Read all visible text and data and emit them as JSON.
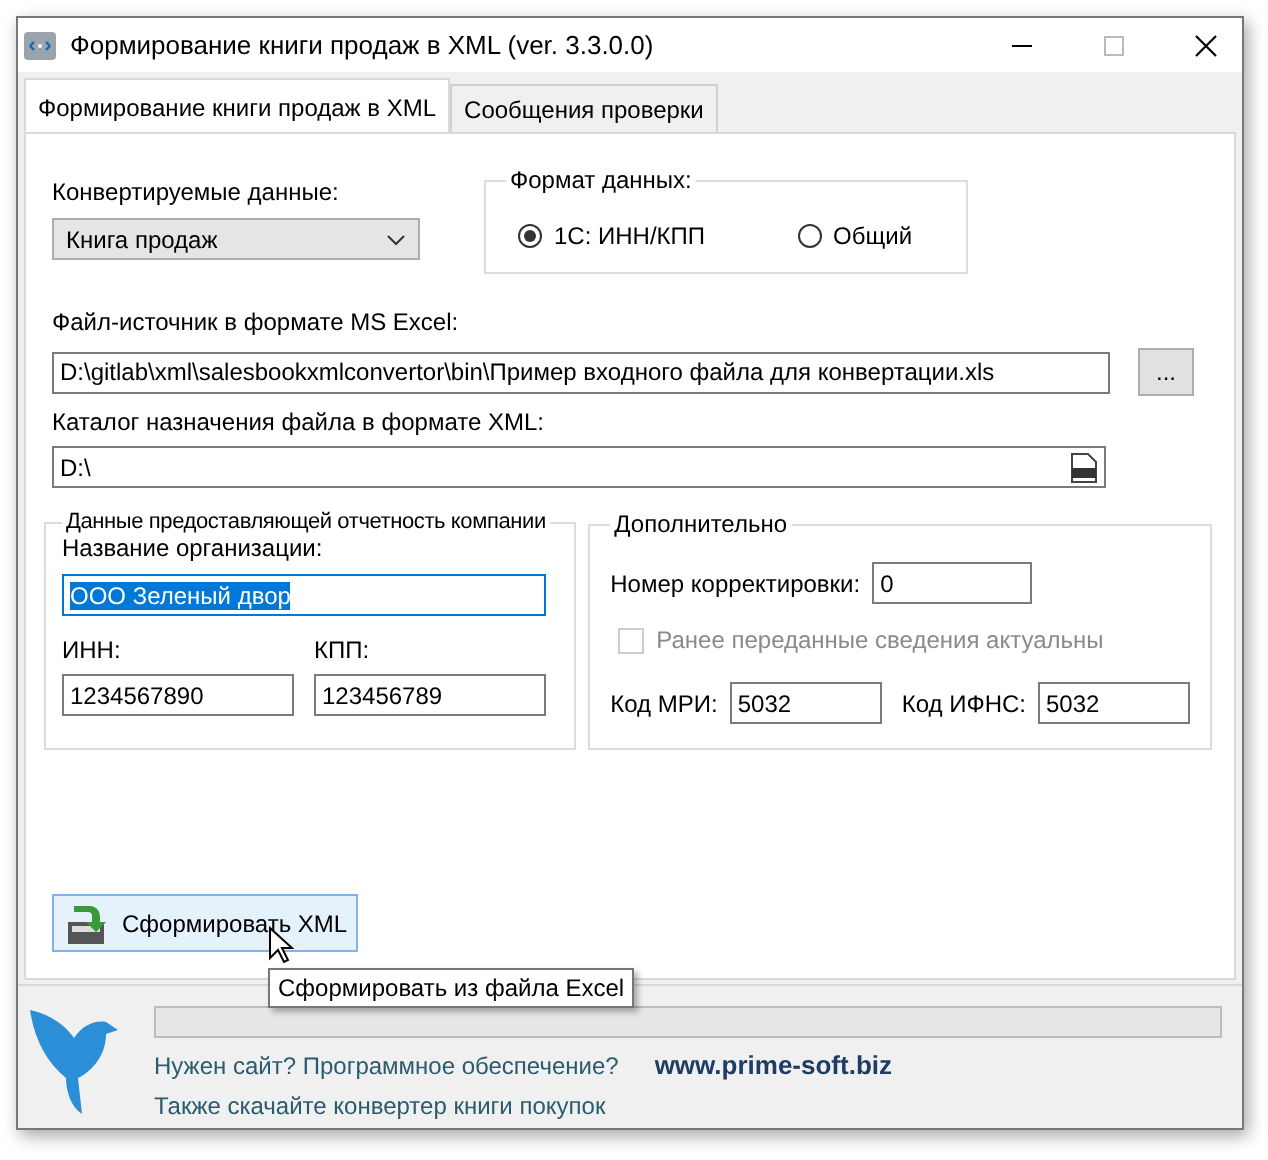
{
  "window": {
    "title": "Формирование книги продаж в XML (ver. 3.3.0.0)"
  },
  "tabs": [
    {
      "label": "Формирование книги продаж в XML",
      "selected": true
    },
    {
      "label": "Сообщения проверки",
      "selected": false
    }
  ],
  "converted_data": {
    "label": "Конвертируемые данные:",
    "value": "Книга продаж"
  },
  "data_format": {
    "title": "Формат данных:",
    "options": [
      {
        "label": "1С: ИНН/КПП",
        "selected": true
      },
      {
        "label": "Общий",
        "selected": false
      }
    ]
  },
  "source_file": {
    "label": "Файл-источник в формате MS Excel:",
    "value": "D:\\gitlab\\xml\\salesbookxmlconvertor\\bin\\Пример входного файла для конвертации.xls",
    "browse": "..."
  },
  "target_dir": {
    "label": "Каталог назначения файла в формате XML:",
    "value": "D:\\"
  },
  "company": {
    "title": "Данные предоставляющей отчетность компании",
    "name_label": "Название организации:",
    "name": "ООО Зеленый двор",
    "name_focused": true,
    "inn_label": "ИНН:",
    "inn": "1234567890",
    "kpp_label": "КПП:",
    "kpp": "123456789"
  },
  "extra": {
    "title": "Дополнительно",
    "correction_label": "Номер корректировки:",
    "correction": "0",
    "checkbox": {
      "label": "Ранее переданные сведения актуальны",
      "checked": false,
      "disabled": true
    },
    "mri_label": "Код МРИ:",
    "mri": "5032",
    "ifns_label": "Код ИФНС:",
    "ifns": "5032"
  },
  "generate_button": {
    "label": "Сформировать XML",
    "hovered": true
  },
  "tooltip": "Сформировать из файла Excel",
  "progress": {
    "level": 0
  },
  "footer": {
    "question": "Нужен сайт? Программное обеспечение?",
    "site": "www.prime-soft.biz",
    "buy_link": "Также скачайте конвертер книги покупок"
  }
}
